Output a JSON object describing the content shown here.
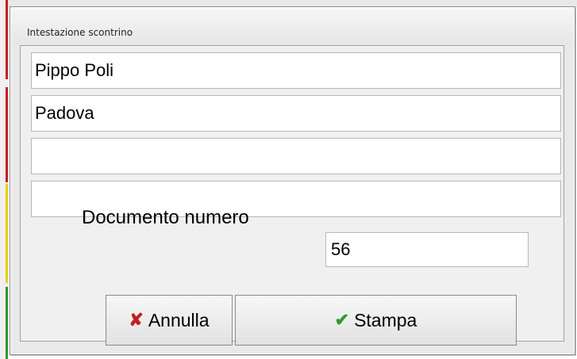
{
  "dialog": {
    "title": "Intestazione scontrino"
  },
  "header_lines": [
    {
      "value": "Pippo Poli"
    },
    {
      "value": "Padova"
    },
    {
      "value": ""
    },
    {
      "value": ""
    }
  ],
  "document": {
    "label": "Documento numero",
    "number": "56"
  },
  "buttons": {
    "cancel_label": "Annulla",
    "cancel_icon": "x-icon",
    "print_label": "Stampa",
    "print_icon": "check-icon"
  },
  "colors": {
    "cancel_icon": "#c0201f",
    "print_icon": "#2e9a2e",
    "strip_red": "#cc1b1b",
    "strip_yellow": "#e8d000",
    "strip_green": "#2a9a2a"
  }
}
